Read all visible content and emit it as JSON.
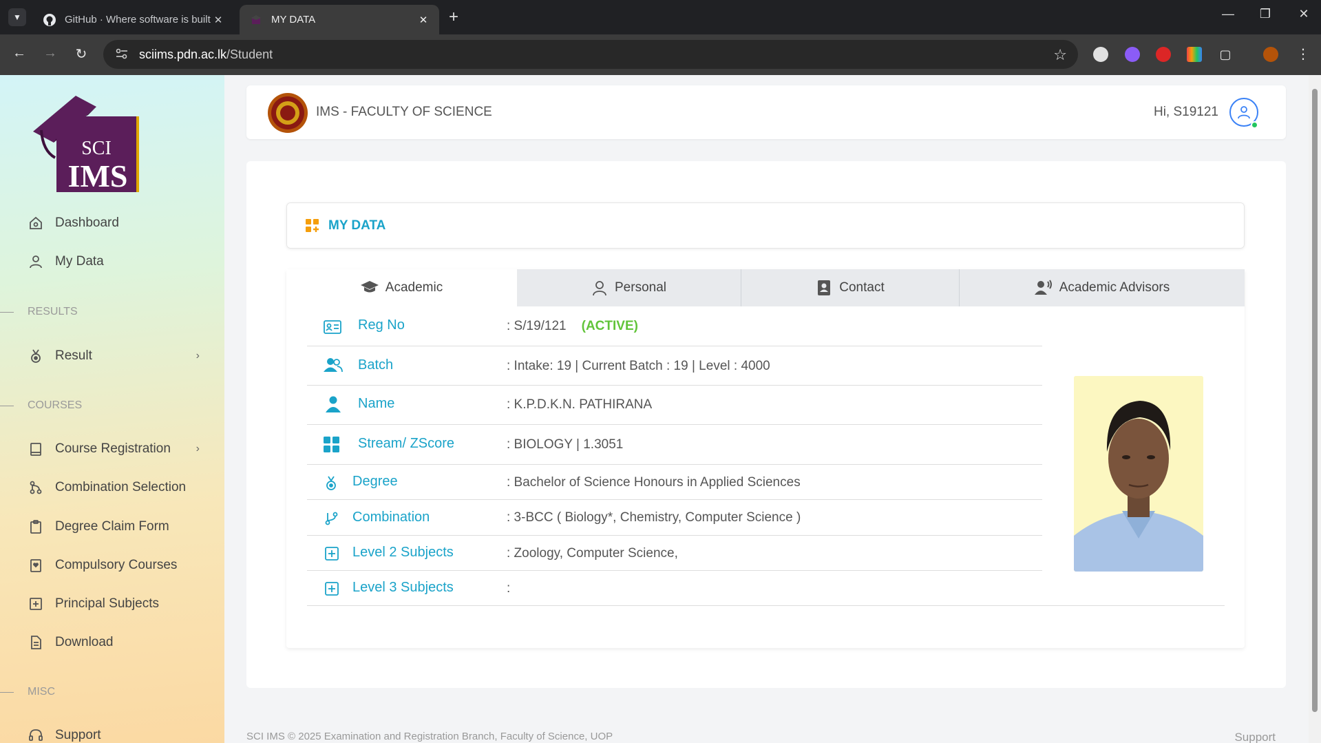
{
  "browser": {
    "tabs": [
      {
        "title": "GitHub · Where software is built",
        "active": false
      },
      {
        "title": "MY DATA",
        "active": true
      }
    ],
    "url_host": "sciims.pdn.ac.lk",
    "url_path": "/Student"
  },
  "sidebar": {
    "logo_text_top": "SCI",
    "logo_text_bottom": "IMS",
    "items_top": [
      {
        "label": "Dashboard",
        "icon": "home-icon"
      },
      {
        "label": "My Data",
        "icon": "user-icon"
      }
    ],
    "section_results": "RESULTS",
    "result_item": {
      "label": "Result",
      "icon": "medal-icon"
    },
    "section_courses": "COURSES",
    "course_items": [
      {
        "label": "Course Registration",
        "icon": "book-icon",
        "has_submenu": true
      },
      {
        "label": "Combination Selection",
        "icon": "git-merge-icon"
      },
      {
        "label": "Degree Claim Form",
        "icon": "clipboard-icon"
      },
      {
        "label": "Compulsory Courses",
        "icon": "book-heart-icon"
      },
      {
        "label": "Principal Subjects",
        "icon": "plus-square-icon"
      },
      {
        "label": "Download",
        "icon": "file-text-icon"
      }
    ],
    "section_misc": "MISC",
    "support_item": {
      "label": "Support",
      "icon": "headset-icon"
    }
  },
  "header": {
    "app_title": "IMS - FACULTY OF SCIENCE",
    "greeting": "Hi, S19121"
  },
  "page": {
    "title": "MY DATA",
    "tabs": [
      {
        "label": "Academic",
        "icon": "graduation-cap-icon",
        "active": true
      },
      {
        "label": "Personal",
        "icon": "user-outline-icon",
        "active": false
      },
      {
        "label": "Contact",
        "icon": "address-book-icon",
        "active": false
      },
      {
        "label": "Academic Advisors",
        "icon": "user-voice-icon",
        "active": false
      }
    ],
    "rows": [
      {
        "label": "Reg No",
        "value": ": S/19/121",
        "status": "(ACTIVE)",
        "icon": "id-card-icon"
      },
      {
        "label": "Batch",
        "value": ": Intake: 19 | Current Batch : 19 | Level : 4000",
        "icon": "users-icon"
      },
      {
        "label": "Name",
        "value": ": K.P.D.K.N. PATHIRANA",
        "icon": "person-icon"
      },
      {
        "label": "Stream/ ZScore",
        "value": ": BIOLOGY | 1.3051",
        "icon": "grid-icon"
      },
      {
        "label": "Degree",
        "value": ": Bachelor of Science Honours in Applied Sciences",
        "icon": "award-icon"
      },
      {
        "label": "Combination",
        "value": ": 3-BCC ( Biology*, Chemistry, Computer Science )",
        "icon": "git-branch-icon"
      },
      {
        "label": "Level 2 Subjects",
        "value": ": Zoology, Computer Science,",
        "icon": "plus-box-icon"
      },
      {
        "label": "Level 3 Subjects",
        "value": ":",
        "icon": "plus-box-icon"
      }
    ]
  },
  "footer": {
    "text": "SCI IMS © 2025 Examination and Registration Branch, Faculty of Science, UOP",
    "support": "Support"
  },
  "colors": {
    "accent": "#1aa3c9",
    "active_status": "#61c43a",
    "logo_purple": "#5b1e5a"
  }
}
